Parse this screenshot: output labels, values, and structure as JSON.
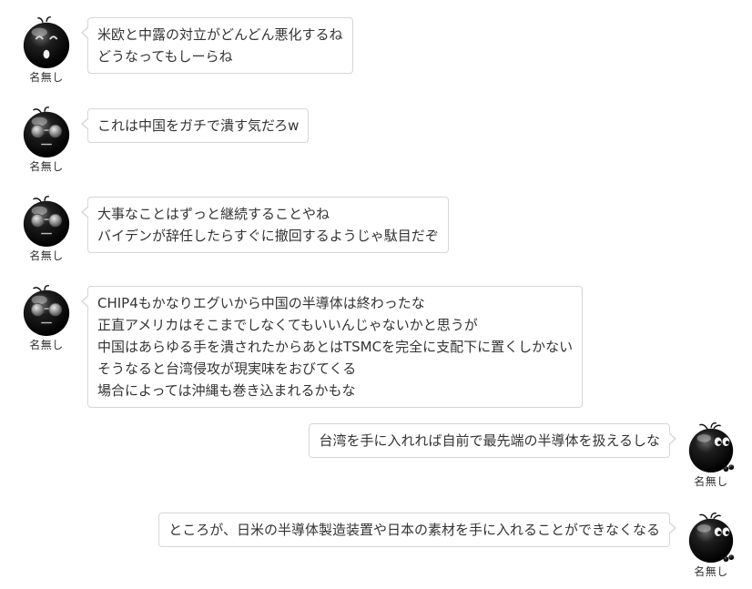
{
  "messages": [
    {
      "side": "left",
      "name": "名無し",
      "avatar_icon": "surprised-face-avatar-icon",
      "lines": [
        "米欧と中露の対立がどんどん悪化するね",
        "どうなってもしーらね"
      ]
    },
    {
      "side": "left",
      "name": "名無し",
      "avatar_icon": "sunglasses-face-avatar-icon",
      "lines": [
        "これは中国をガチで潰す気だろw"
      ]
    },
    {
      "side": "left",
      "name": "名無し",
      "avatar_icon": "sunglasses-face-avatar-icon",
      "lines": [
        "大事なことはずっと継続することやね",
        "バイデンが辞任したらすぐに撤回するようじゃ駄目だぞ"
      ]
    },
    {
      "side": "left",
      "name": "名無し",
      "avatar_icon": "sunglasses-face-avatar-icon",
      "lines": [
        "CHIP4もかなりエグいから中国の半導体は終わったな",
        "正直アメリカはそこまでしなくてもいいんじゃないかと思うが",
        "中国はあらゆる手を潰されたからあとはTSMCを完全に支配下に置くしかない",
        "そうなると台湾侵攻が現実味をおびてくる",
        "場合によっては沖縄も巻き込まれるかもな"
      ]
    },
    {
      "side": "right",
      "name": "名無し",
      "avatar_icon": "sideeye-face-avatar-icon",
      "lines": [
        "台湾を手に入れれば自前で最先端の半導体を扱えるしな"
      ]
    },
    {
      "side": "right",
      "name": "名無し",
      "avatar_icon": "sideeye-face-avatar-icon",
      "lines": [
        "ところが、日米の半導体製造装置や日本の素材を手に入れることができなくなる"
      ]
    }
  ]
}
